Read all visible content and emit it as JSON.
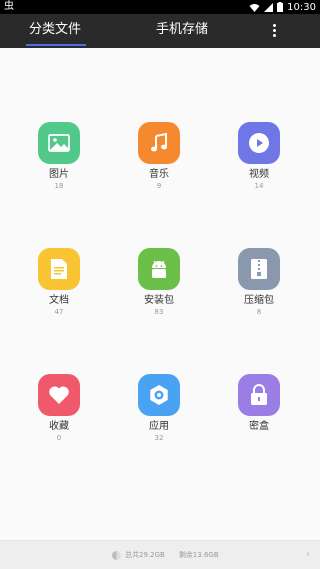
{
  "status_bar": {
    "left_icon": "bug-icon",
    "time": "10:30",
    "icons": [
      "wifi-icon",
      "signal-icon",
      "battery-icon"
    ]
  },
  "tabs": [
    {
      "label": "分类文件",
      "active": true
    },
    {
      "label": "手机存储",
      "active": false
    }
  ],
  "menu_icon": "more-vert-icon",
  "accent_color": "#4e6ee8",
  "categories": [
    {
      "label": "图片",
      "count": "18",
      "icon": "image-icon",
      "color": "#52c88b"
    },
    {
      "label": "音乐",
      "count": "9",
      "icon": "music-icon",
      "color": "#f5892f"
    },
    {
      "label": "视频",
      "count": "14",
      "icon": "play-icon",
      "color": "#6f76e6"
    },
    {
      "label": "文档",
      "count": "47",
      "icon": "document-icon",
      "color": "#f8c432"
    },
    {
      "label": "安装包",
      "count": "83",
      "icon": "android-icon",
      "color": "#6cc04a"
    },
    {
      "label": "压缩包",
      "count": "8",
      "icon": "zip-icon",
      "color": "#8a98ad"
    },
    {
      "label": "收藏",
      "count": "0",
      "icon": "heart-icon",
      "color": "#f0596c"
    },
    {
      "label": "应用",
      "count": "32",
      "icon": "gear-icon",
      "color": "#4aa2f2"
    },
    {
      "label": "密盒",
      "count": "",
      "icon": "lock-icon",
      "color": "#9a7ee5"
    }
  ],
  "storage": {
    "total": "总共29.2GB",
    "free": "剩余13.6GB"
  }
}
